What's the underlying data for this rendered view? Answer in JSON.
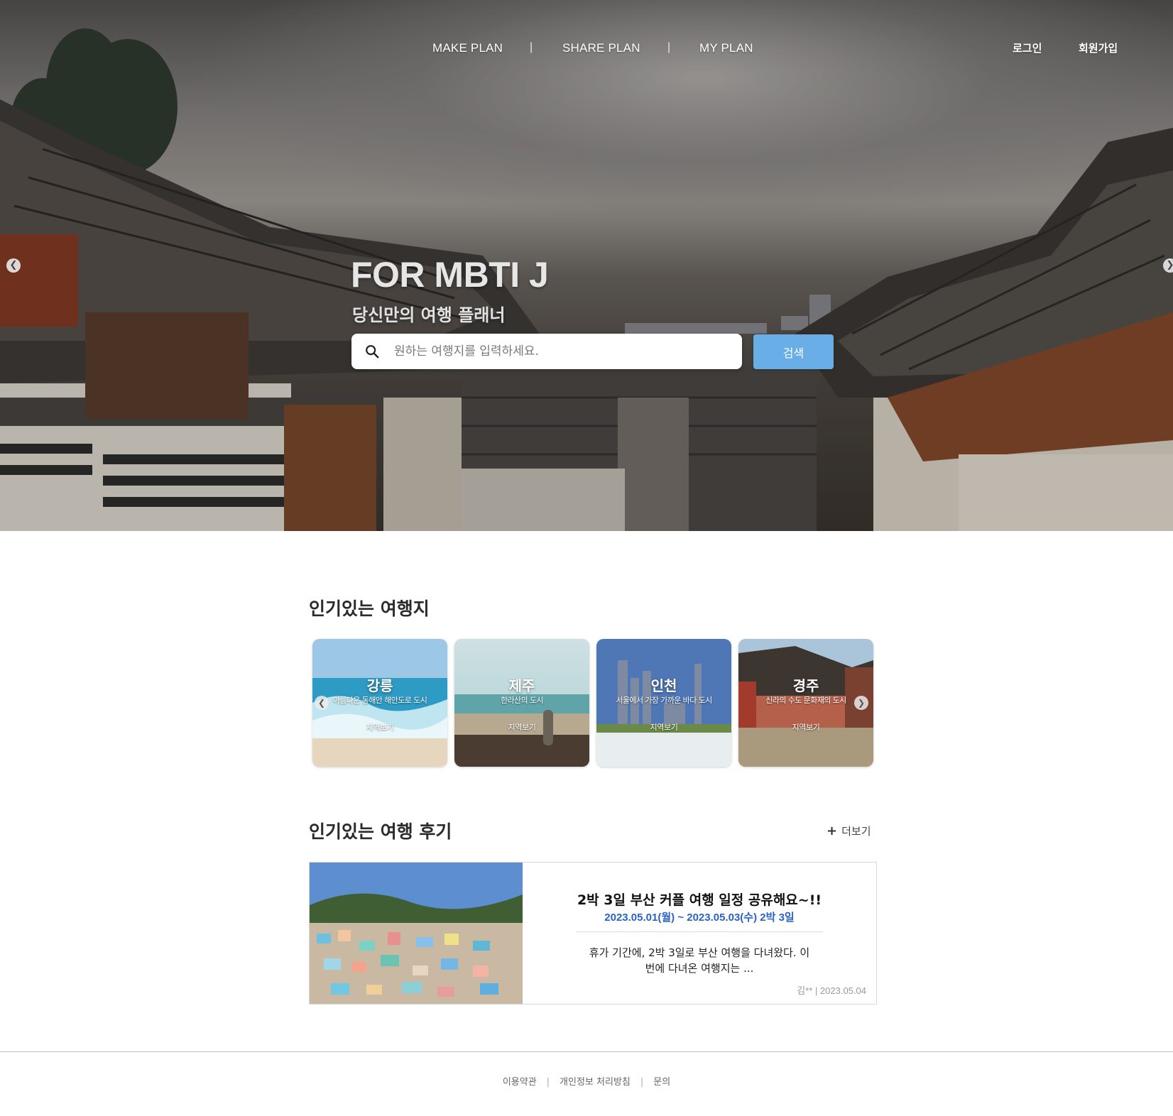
{
  "nav": {
    "items": [
      {
        "label": "MAKE PLAN"
      },
      {
        "label": "SHARE PLAN"
      },
      {
        "label": "MY PLAN"
      }
    ],
    "separator": "|"
  },
  "auth": {
    "login": "로그인",
    "signup": "회원가입"
  },
  "hero": {
    "title": "FOR MBTI J",
    "subtitle": "당신만의 여행 플래너",
    "search_placeholder": "원하는 여행지를 입력하세요.",
    "search_button": "검색",
    "prev_icon": "chevron-left-icon",
    "next_icon": "chevron-right-icon"
  },
  "popular_destinations": {
    "title": "인기있는 여행지",
    "cards": [
      {
        "name": "강릉",
        "desc": "아름다운 동해안 해안도로 도시",
        "view": "지역보기"
      },
      {
        "name": "제주",
        "desc": "한라산의 도시",
        "view": "지역보기"
      },
      {
        "name": "인천",
        "desc": "서울에서 가장 가까운 바다 도시",
        "view": "지역보기"
      },
      {
        "name": "경주",
        "desc": "신라의 수도 문화재의 도시",
        "view": "지역보기"
      }
    ]
  },
  "popular_reviews": {
    "title": "인기있는 여행 후기",
    "more": "더보기",
    "items": [
      {
        "title": "2박 3일 부산 커플 여행 일정 공유해요~!!",
        "date": "2023.05.01(월) ~ 2023.05.03(수) 2박 3일",
        "body_line1": "휴가 기간에, 2박 3일로 부산 여행을 다녀왔다. 이",
        "body_line2": "번에 다녀온 여행지는 ...",
        "meta": "김** | 2023.05.04"
      }
    ]
  },
  "footer": {
    "links": [
      "이용약관",
      "개인정보 처리방침",
      "문의"
    ],
    "separator": "|"
  },
  "colors": {
    "accent": "#6aaee8",
    "date_blue": "#2a62c9"
  }
}
